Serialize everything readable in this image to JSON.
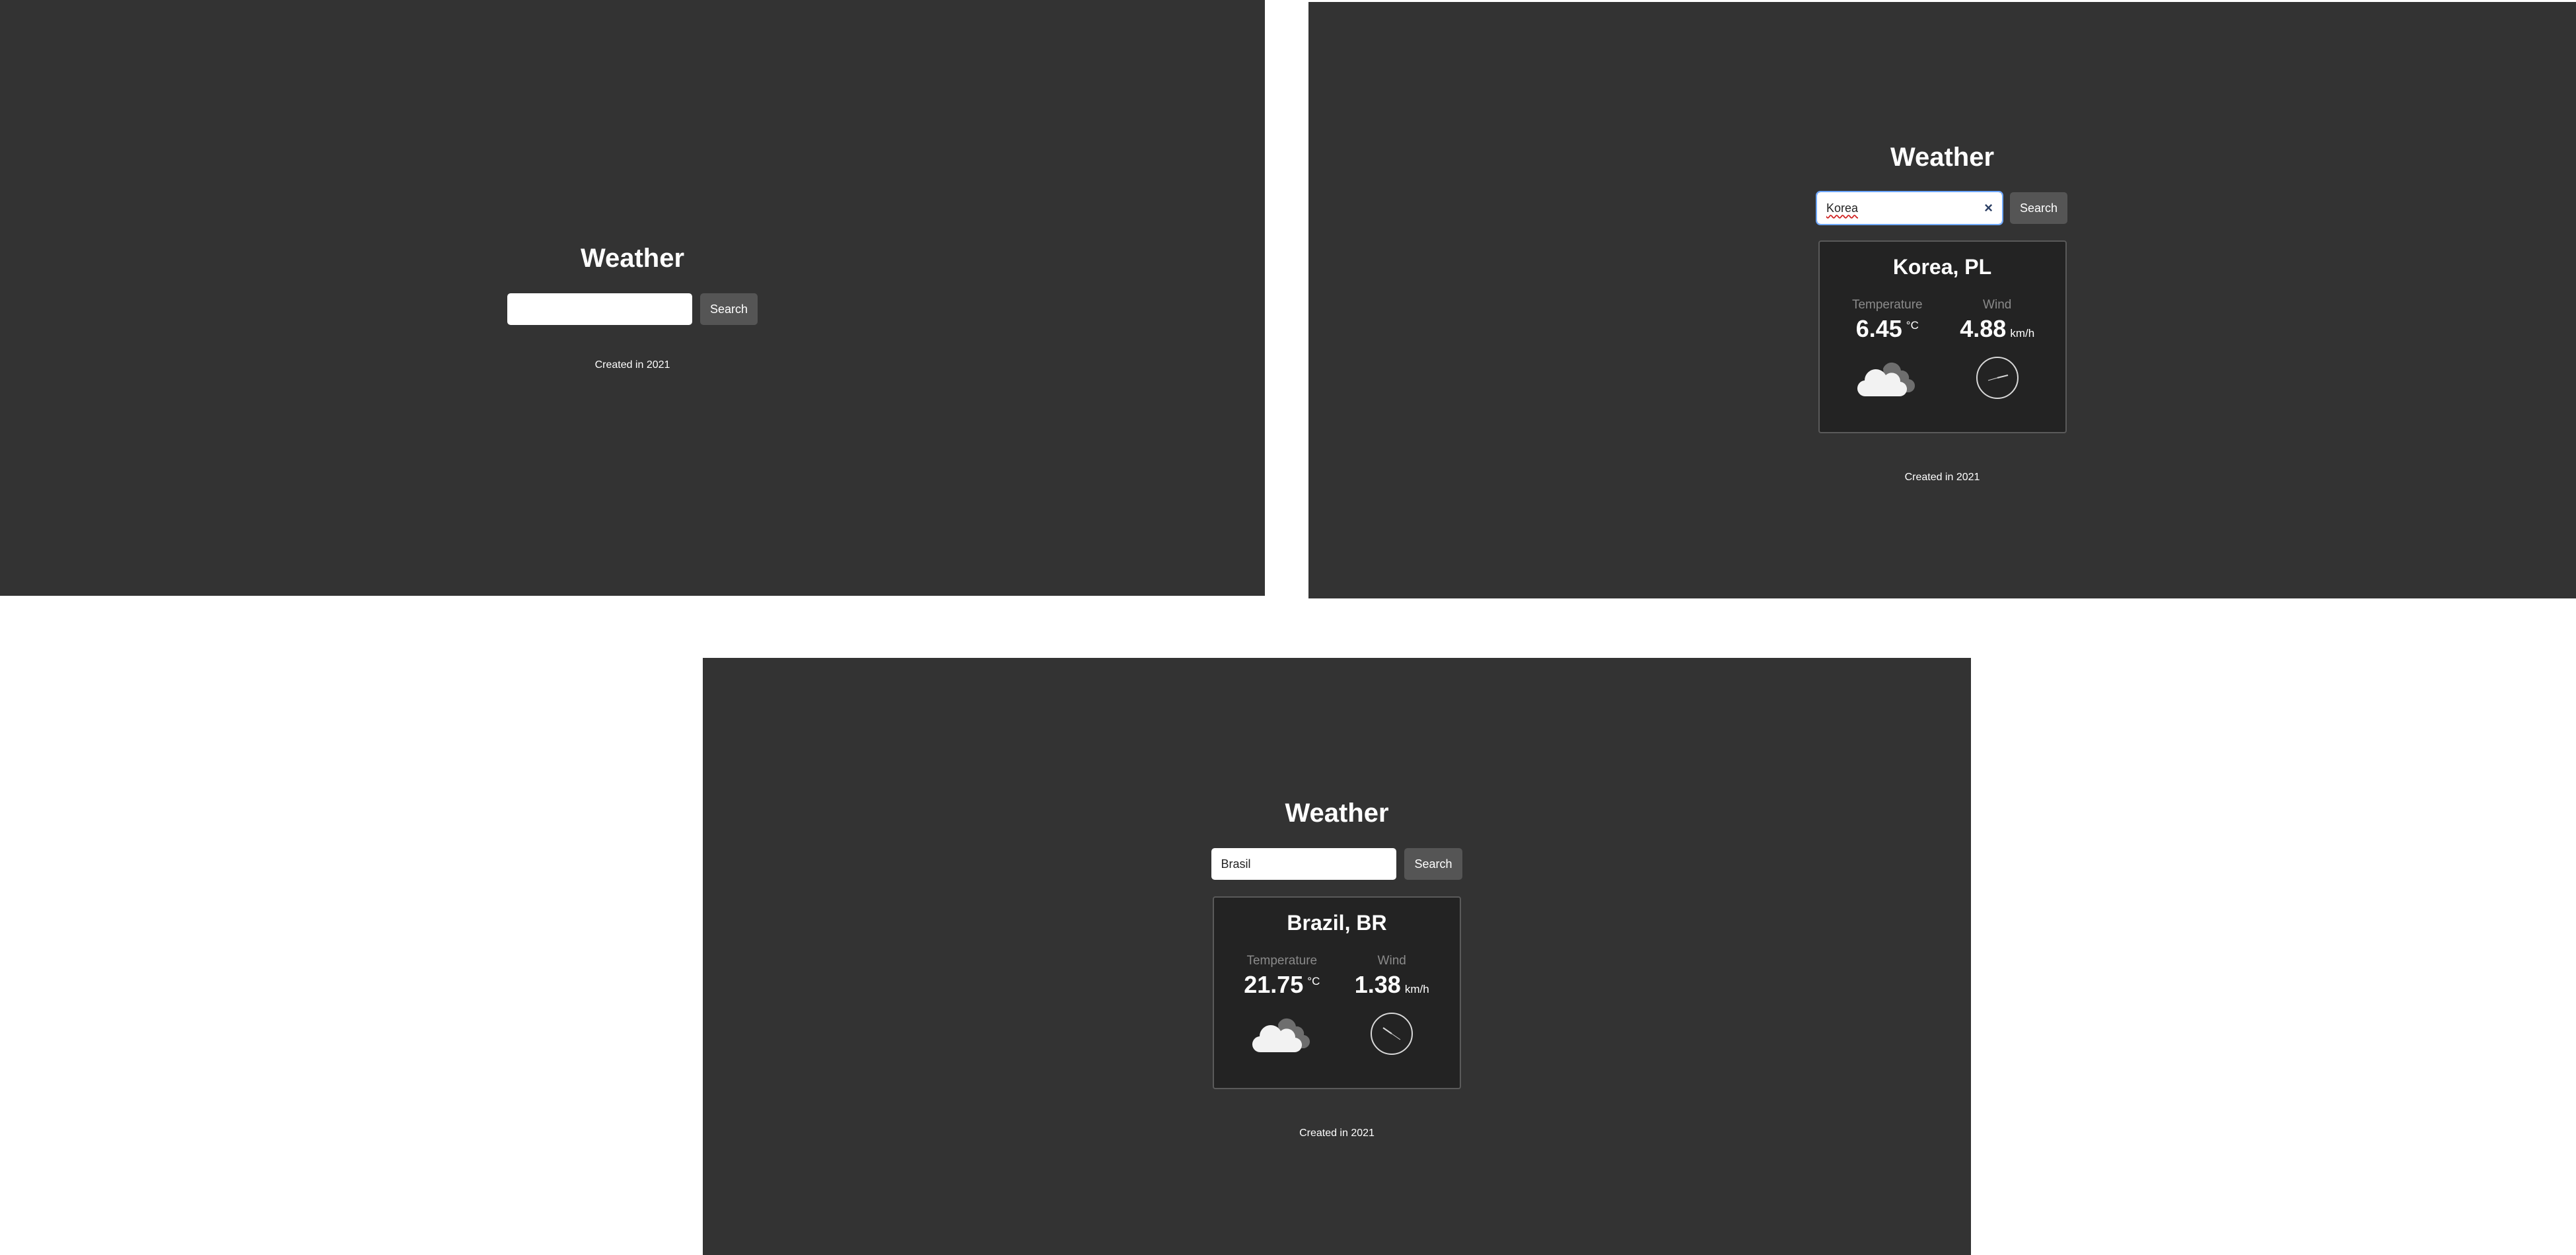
{
  "screens": [
    {
      "title": "Weather",
      "search_value": "",
      "search_button": "Search",
      "footer": "Created in 2021"
    },
    {
      "title": "Weather",
      "search_value": "Korea",
      "search_button": "Search",
      "clear_icon": "×",
      "city": "Korea, PL",
      "temperature_label": "Temperature",
      "temperature_value": "6.45",
      "temperature_unit": "°C",
      "wind_label": "Wind",
      "wind_value": "4.88",
      "wind_unit": "km/h",
      "weather_icon": "cloud-icon",
      "wind_icon": "wind-direction-icon",
      "footer": "Created in 2021"
    },
    {
      "title": "Weather",
      "search_value": "Brasil",
      "search_button": "Search",
      "city": "Brazil, BR",
      "temperature_label": "Temperature",
      "temperature_value": "21.75",
      "temperature_unit": "°C",
      "wind_label": "Wind",
      "wind_value": "1.38",
      "wind_unit": "km/h",
      "weather_icon": "cloud-icon",
      "wind_icon": "wind-direction-icon",
      "footer": "Created in 2021"
    }
  ],
  "colors": {
    "background": "#333333",
    "card": "#232323",
    "button": "#555555",
    "muted_label": "#8a8a8a",
    "text": "#ffffff"
  }
}
